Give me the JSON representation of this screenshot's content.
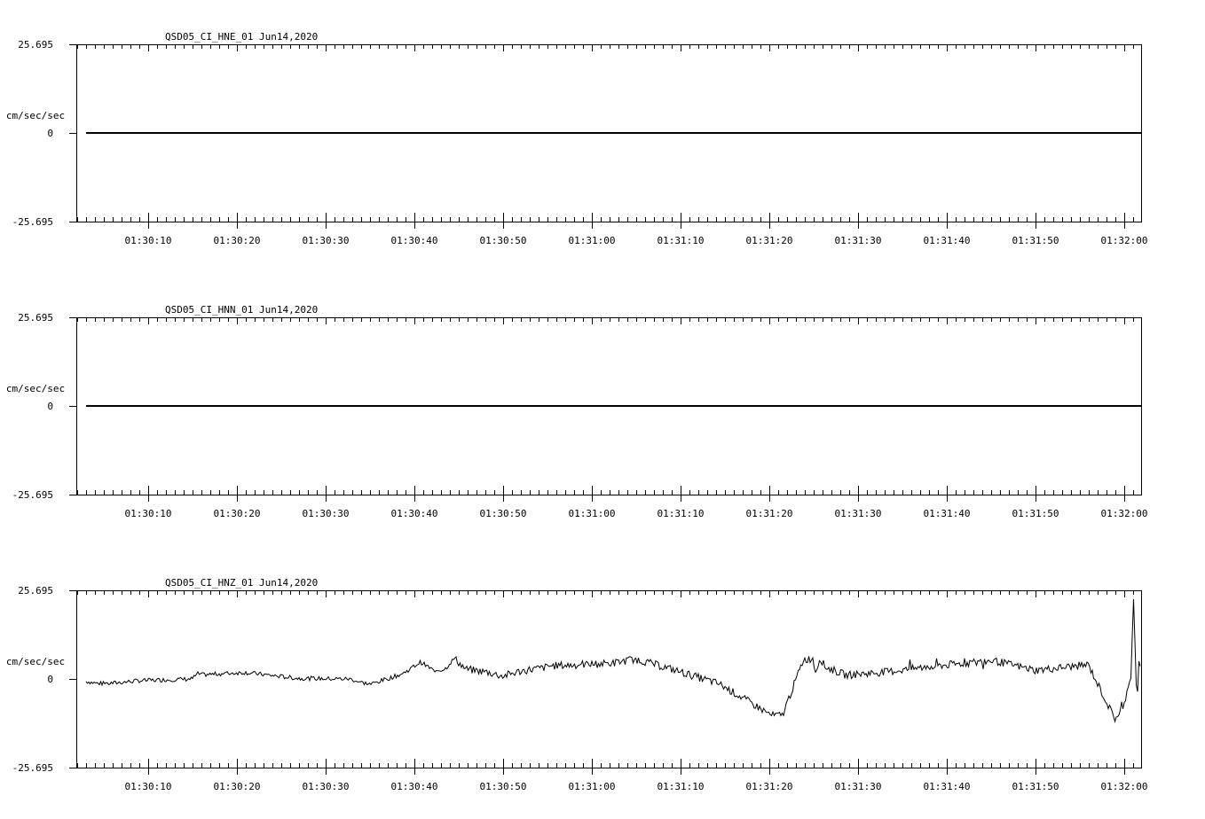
{
  "chart_data": [
    {
      "type": "line",
      "title": "QSD05_CI_HNE_01  Jun14,2020",
      "ylabel": "cm/sec/sec",
      "ylim": [
        -25.695,
        25.695
      ],
      "y_tick_labels": [
        "25.695",
        "0",
        "-25.695"
      ],
      "x_tick_labels": [
        "01:30:10",
        "01:30:20",
        "01:30:30",
        "01:30:40",
        "01:30:50",
        "01:31:00",
        "01:31:10",
        "01:31:20",
        "01:31:30",
        "01:31:40",
        "01:31:50",
        "01:32:00"
      ],
      "series": [
        {
          "x": [
            0,
            1
          ],
          "y": [
            0,
            0
          ]
        }
      ]
    },
    {
      "type": "line",
      "title": "QSD05_CI_HNN_01  Jun14,2020",
      "ylabel": "cm/sec/sec",
      "ylim": [
        -25.695,
        25.695
      ],
      "y_tick_labels": [
        "25.695",
        "0",
        "-25.695"
      ],
      "x_tick_labels": [
        "01:30:10",
        "01:30:20",
        "01:30:30",
        "01:30:40",
        "01:30:50",
        "01:31:00",
        "01:31:10",
        "01:31:20",
        "01:31:30",
        "01:31:40",
        "01:31:50",
        "01:32:00"
      ],
      "series": [
        {
          "x": [
            0,
            1
          ],
          "y": [
            0,
            0
          ]
        }
      ]
    },
    {
      "type": "line",
      "title": "QSD05_CI_HNZ_01  Jun14,2020",
      "ylabel": "cm/sec/sec",
      "ylim": [
        -25.695,
        25.695
      ],
      "y_tick_labels": [
        "25.695",
        "0",
        "-25.695"
      ],
      "x_tick_labels": [
        "01:30:10",
        "01:30:20",
        "01:30:30",
        "01:30:40",
        "01:30:50",
        "01:31:00",
        "01:31:10",
        "01:31:20",
        "01:31:30",
        "01:31:40",
        "01:31:50",
        "01:32:00"
      ],
      "series": [
        {
          "x": [
            0,
            0.011,
            0.022,
            0.05,
            0.1,
            0.106,
            0.11,
            0.15,
            0.2,
            0.25,
            0.262,
            0.27,
            0.29,
            0.3,
            0.317,
            0.33,
            0.34,
            0.349,
            0.36,
            0.38,
            0.395,
            0.403,
            0.41,
            0.42,
            0.433,
            0.44,
            0.46,
            0.5,
            0.52,
            0.55,
            0.6,
            0.65,
            0.66,
            0.68,
            0.689,
            0.691,
            0.693,
            0.696,
            0.7,
            0.72,
            0.76,
            0.8,
            0.86,
            0.9,
            0.95,
            0.975,
            0.983,
            0.985,
            0.987,
            0.99,
            0.993,
            0.996,
            0.998,
            1
          ],
          "y": [
            -0.7,
            -1.3,
            -1.3,
            -0.5,
            0,
            1.5,
            1.2,
            1.9,
            0.2,
            0,
            -1.1,
            -1.5,
            0.5,
            1.5,
            4.9,
            2.4,
            2.8,
            6.0,
            2.8,
            2.0,
            0.8,
            1.5,
            2.1,
            2.7,
            3.2,
            3.8,
            4.0,
            4.6,
            5.8,
            3.3,
            -1.4,
            -10.6,
            -10.5,
            5.6,
            5.9,
            2.1,
            3.6,
            6.2,
            3.6,
            1.1,
            2.1,
            3.6,
            5.3,
            2.5,
            4.1,
            -11.6,
            -8.4,
            -5.9,
            -2.2,
            -1.6,
            23.5,
            -7.3,
            5.5,
            0.8
          ],
          "noise": 1.4
        }
      ]
    }
  ]
}
